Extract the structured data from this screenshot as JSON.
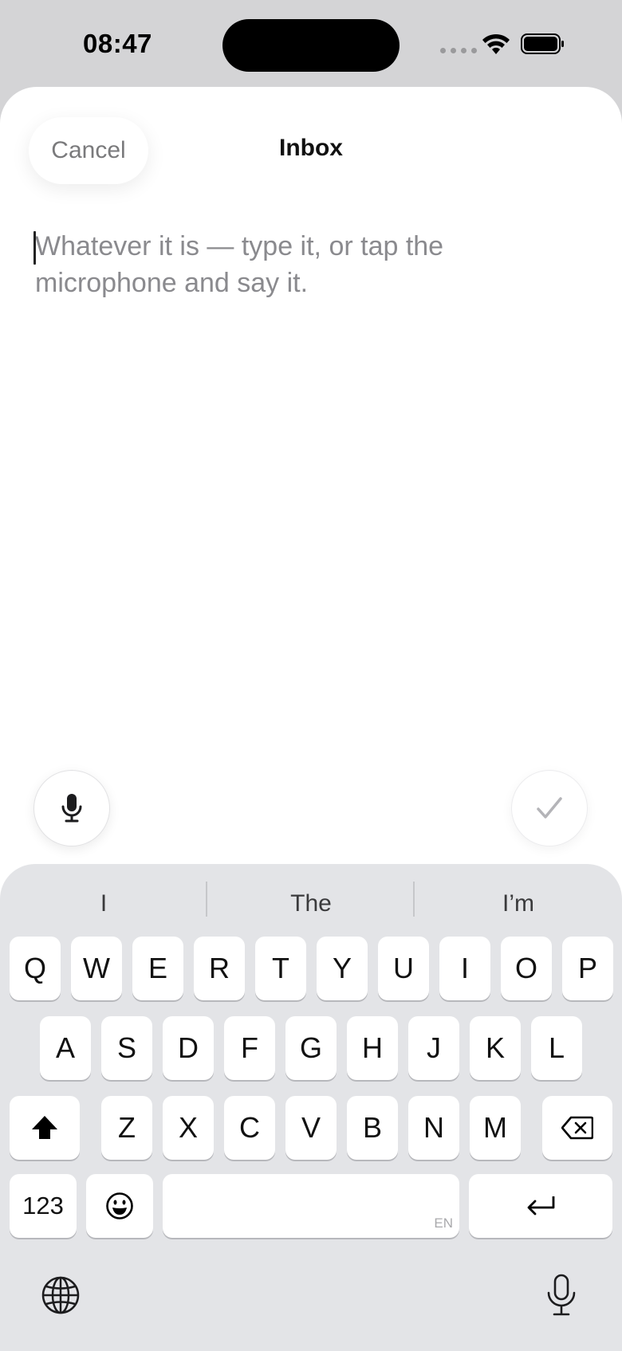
{
  "status_bar": {
    "time": "08:47"
  },
  "sheet": {
    "cancel_label": "Cancel",
    "title": "Inbox",
    "entry_placeholder": "Whatever it is — type it, or tap the microphone and say it."
  },
  "keyboard": {
    "suggestions": [
      "I",
      "The",
      "I’m"
    ],
    "row1": [
      "Q",
      "W",
      "E",
      "R",
      "T",
      "Y",
      "U",
      "I",
      "O",
      "P"
    ],
    "row2": [
      "A",
      "S",
      "D",
      "F",
      "G",
      "H",
      "J",
      "K",
      "L"
    ],
    "row3": [
      "Z",
      "X",
      "C",
      "V",
      "B",
      "N",
      "M"
    ],
    "numbers_label": "123",
    "space_language": "EN"
  },
  "icons": {
    "wifi": "wifi-icon",
    "battery": "battery-icon",
    "dictation": "microphone-icon",
    "done": "checkmark-icon",
    "shift": "shift-icon",
    "delete": "backspace-icon",
    "emoji": "emoji-icon",
    "return": "return-icon",
    "globe": "globe-icon",
    "keyboard_dictation": "microphone-icon"
  }
}
